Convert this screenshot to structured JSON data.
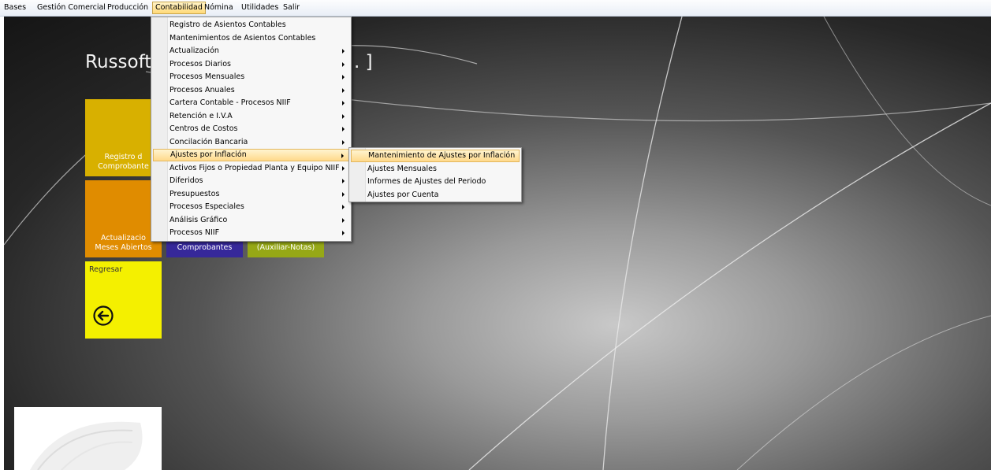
{
  "menubar": {
    "items": [
      "Bases",
      "Gestión Comercial",
      "Producción",
      "Contabilidad",
      "Nómina",
      "Utilidades",
      "Salir"
    ],
    "active_index": 3
  },
  "desktop": {
    "title": "Russoft",
    "title_suffix": ". ]",
    "tiles": [
      {
        "label_lines": [
          "Registro d",
          "Comprobante"
        ],
        "color": "#d8b000"
      },
      {
        "label_lines": [
          "Actualizacio",
          "Meses Abiertos"
        ],
        "color": "#e08c00"
      },
      {
        "label_lines": [
          "Comprobantes"
        ],
        "color": "#36289a"
      },
      {
        "label_lines": [
          "(Auxiliar-Notas)"
        ],
        "color": "#96a816"
      },
      {
        "label_lines": [
          "Regresar"
        ],
        "color": "#f4f000",
        "icon": "arrow-left-circle-icon"
      }
    ]
  },
  "contabilidad_menu": {
    "items": [
      {
        "label": "Registro de Asientos Contables",
        "submenu": false
      },
      {
        "label": "Mantenimientos de Asientos Contables",
        "submenu": false
      },
      {
        "label": "Actualización",
        "submenu": true
      },
      {
        "label": "Procesos Diarios",
        "submenu": true
      },
      {
        "label": "Procesos Mensuales",
        "submenu": true
      },
      {
        "label": "Procesos Anuales",
        "submenu": true
      },
      {
        "label": "Cartera Contable - Procesos NIIF",
        "submenu": true
      },
      {
        "label": "Retención e I.V.A",
        "submenu": true
      },
      {
        "label": "Centros de Costos",
        "submenu": true
      },
      {
        "label": "Concilación Bancaria",
        "submenu": true
      },
      {
        "label": "Ajustes por Inflación",
        "submenu": true,
        "highlighted": true
      },
      {
        "label": "Activos Fijos o Propiedad Planta y Equipo NIIF",
        "submenu": true
      },
      {
        "label": "Diferidos",
        "submenu": true
      },
      {
        "label": "Presupuestos",
        "submenu": true
      },
      {
        "label": "Procesos Especiales",
        "submenu": true
      },
      {
        "label": "Análisis Gráfico",
        "submenu": true
      },
      {
        "label": "Procesos NIIF",
        "submenu": true
      }
    ]
  },
  "ajustes_submenu": {
    "items": [
      {
        "label": "Mantenimiento de Ajustes por Inflación",
        "highlighted": true
      },
      {
        "label": "Ajustes Mensuales"
      },
      {
        "label": "Informes de Ajustes del Periodo"
      },
      {
        "label": "Ajustes por Cuenta"
      }
    ]
  },
  "colors": {
    "menu_highlight": "#ffd98b",
    "menubar_bg": "#e9eef6"
  }
}
